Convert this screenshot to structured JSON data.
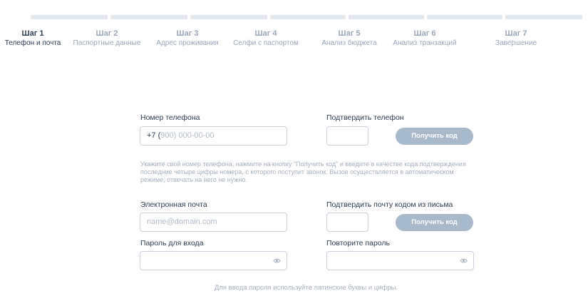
{
  "steps": [
    {
      "num": "Шаг 1",
      "label": "Телефон и почта"
    },
    {
      "num": "Шаг 2",
      "label": "Паспортные данные"
    },
    {
      "num": "Шаг 3",
      "label": "Адрес проживания"
    },
    {
      "num": "Шаг 4",
      "label": "Селфи с паспортом"
    },
    {
      "num": "Шаг 5",
      "label": "Анализ бюджета"
    },
    {
      "num": "Шаг 6",
      "label": "Анализ транзакций"
    },
    {
      "num": "Шаг 7",
      "label": "Завершение"
    }
  ],
  "form": {
    "phone_label": "Номер телефона",
    "phone_prefix": "+7 (",
    "phone_placeholder": "900) 000-00-00",
    "confirm_phone_label": "Подтвердить телефон",
    "get_code_label": "Получить код",
    "phone_hint": "Укажите свой номер телефона, нажмите на кнопку \"Получить код\" и введите в качестве кода подтверждения последние четыре цифры номера, с которого поступит звонок. Вызов осуществляется в автоматическом режиме, отвечать на него не нужно.",
    "email_label": "Электронная почта",
    "email_placeholder": "name@domain.com",
    "confirm_email_label": "Подтвердить почту кодом из письма",
    "password_label": "Пароль для входа",
    "repeat_password_label": "Повторите пароль",
    "password_hint": "Для ввода пароля используйте латинские буквы и цифры."
  },
  "colors": {
    "accent_button": "#a9b9cc",
    "text_dark": "#2d3c50",
    "text_muted": "#9aa6b7",
    "progress_track": "#e3e8ef"
  },
  "icons": {
    "password_toggle": "eye-icon"
  },
  "current_step": 1
}
